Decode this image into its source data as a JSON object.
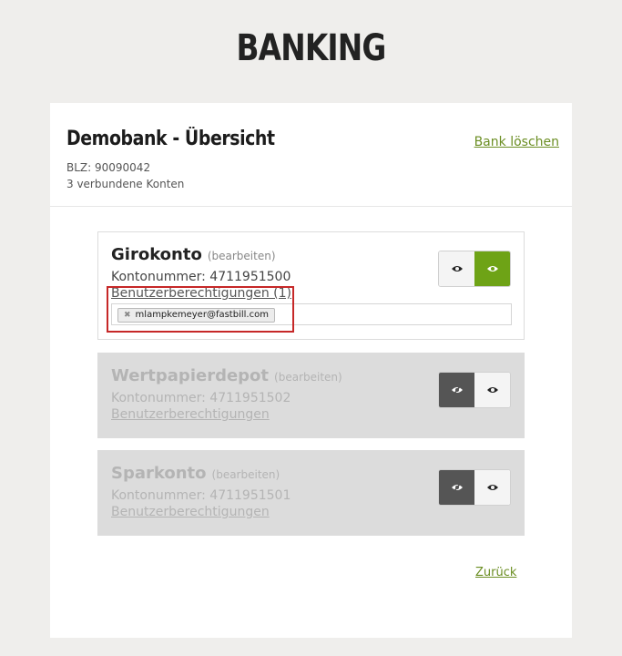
{
  "page": {
    "title": "BANKING"
  },
  "bank": {
    "title": "Demobank - Übersicht",
    "blz": "BLZ: 90090042",
    "connected": "3 verbundene Konten",
    "delete_label": "Bank löschen"
  },
  "accounts": [
    {
      "name": "Girokonto",
      "edit_label": "(bearbeiten)",
      "number": "Kontonummer: 4711951500",
      "permissions_label": "Benutzerberechtigungen (1)",
      "permission_tags": [
        "mlampkemeyer@fastbill.com"
      ],
      "visible": true
    },
    {
      "name": "Wertpapierdepot",
      "edit_label": "(bearbeiten)",
      "number": "Kontonummer: 4711951502",
      "permissions_label": "Benutzerberechtigungen",
      "visible": false
    },
    {
      "name": "Sparkonto",
      "edit_label": "(bearbeiten)",
      "number": "Kontonummer: 4711951501",
      "permissions_label": "Benutzerberechtigungen",
      "visible": false
    }
  ],
  "icons": {
    "show": "eye-icon",
    "hide": "eye-slash-icon",
    "remove": "close-icon"
  },
  "colors": {
    "accent": "#6ea316",
    "link": "#6b8e23",
    "highlight": "#c62828"
  },
  "back_label": "Zurück"
}
